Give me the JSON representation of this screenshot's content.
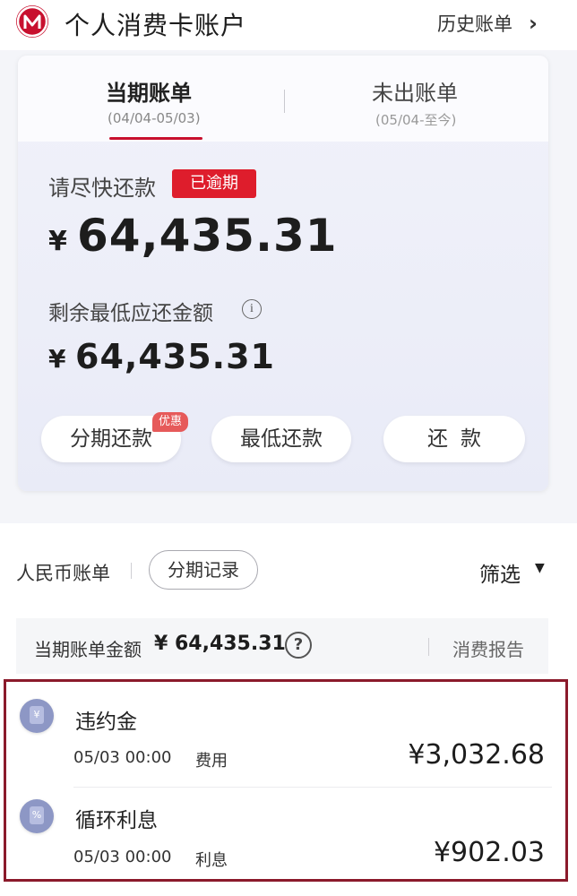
{
  "header": {
    "title": "个人消费卡账户",
    "history_link": "历史账单",
    "chevron": "›"
  },
  "tabs": [
    {
      "label": "当期账单",
      "date_range": "(04/04-05/03)"
    },
    {
      "label": "未出账单",
      "date_range": "(05/04-至今)"
    }
  ],
  "bill": {
    "prompt": "请尽快还款",
    "status_badge": "已逾期",
    "currency": "¥",
    "amount_due": "64,435.31",
    "min_label": "剩余最低应还金额",
    "info_icon": "i",
    "min_amount": "64,435.31"
  },
  "actions": {
    "installment": "分期还款",
    "promo_badge": "优惠",
    "min_pay": "最低还款",
    "pay": "还款"
  },
  "filters": {
    "currency_tab": "人民币账单",
    "installment_records": "分期记录",
    "filter_label": "筛选",
    "filter_arrow": "▼"
  },
  "summary": {
    "label": "当期账单金额",
    "amount": "¥ 64,435.31",
    "help_icon": "?",
    "report_link": "消费报告"
  },
  "transactions": [
    {
      "icon": "yuan-doc-icon",
      "icon_glyph": "¥",
      "name": "违约金",
      "datetime": "05/03 00:00",
      "category": "费用",
      "amount": "¥3,032.68"
    },
    {
      "icon": "percent-doc-icon",
      "icon_glyph": "%",
      "name": "循环利息",
      "datetime": "05/03 00:00",
      "category": "利息",
      "amount": "¥902.03"
    }
  ],
  "colors": {
    "brand_red": "#c8102e",
    "overdue_red": "#de1d2c",
    "highlight_border": "#8b1a2b",
    "tx_icon": "#8d97c5"
  }
}
